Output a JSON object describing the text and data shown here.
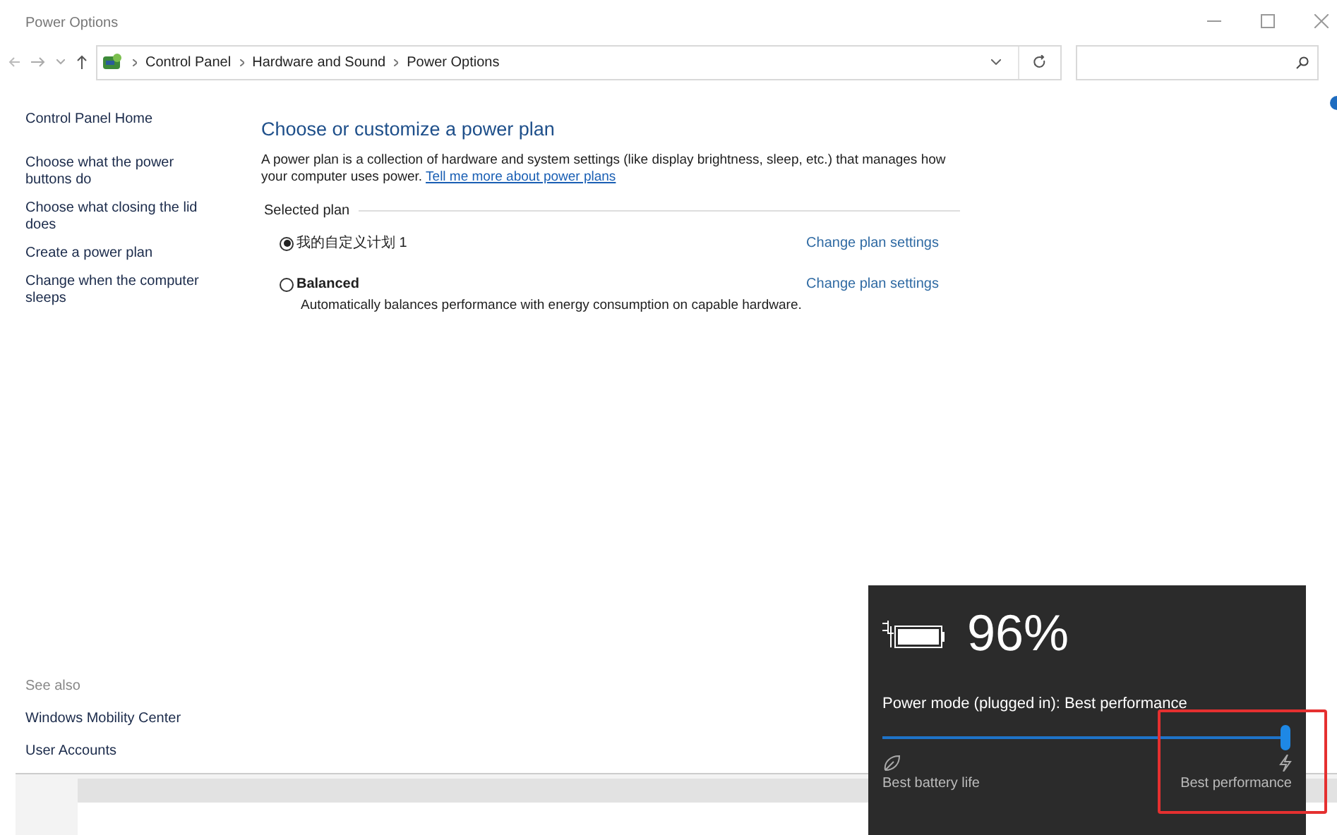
{
  "window": {
    "title": "Power Options"
  },
  "address_bar": {
    "breadcrumbs": [
      "Control Panel",
      "Hardware and Sound",
      "Power Options"
    ]
  },
  "sidebar": {
    "items": [
      "Control Panel Home",
      "Choose what the power buttons do",
      "Choose what closing the lid does",
      "Create a power plan",
      "Change when the computer sleeps"
    ],
    "see_also": {
      "heading": "See also",
      "items": [
        "Windows Mobility Center",
        "User Accounts"
      ]
    }
  },
  "content": {
    "title": "Choose or customize a power plan",
    "description": "A power plan is a collection of hardware and system settings (like display brightness, sleep, etc.) that manages how your computer uses power.",
    "link": "Tell me more about power plans",
    "group_label": "Selected plan",
    "plans": [
      {
        "name": "我的自定义计划 1",
        "bold": false,
        "selected": true,
        "action": "Change plan settings"
      },
      {
        "name": "Balanced",
        "bold": true,
        "selected": false,
        "description": "Automatically balances performance with energy consumption on capable hardware.",
        "action": "Change plan settings"
      }
    ]
  },
  "battery_flyout": {
    "percent": "96%",
    "mode": "Power mode (plugged in): Best performance",
    "slider": {
      "level": 1
    },
    "left_label": "Best battery life",
    "right_label": "Best performance",
    "highlighted": true
  }
}
